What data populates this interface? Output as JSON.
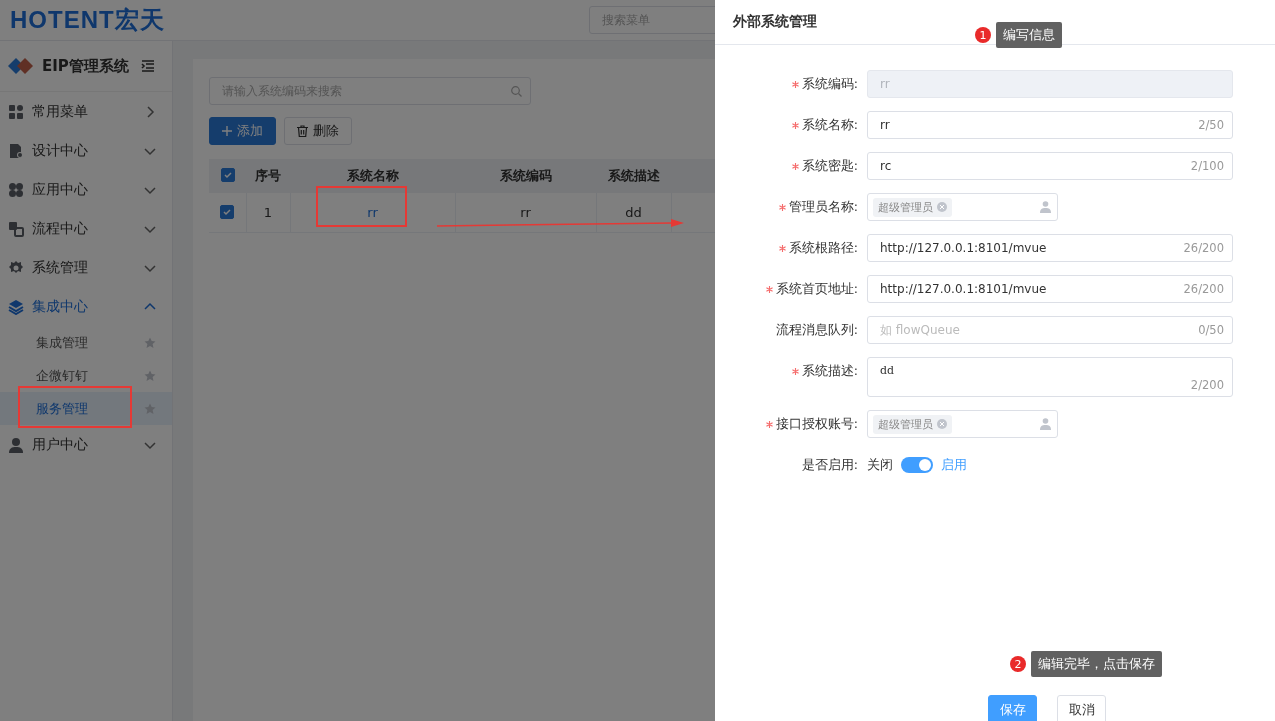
{
  "header": {
    "logo": "HOTENT宏天",
    "search_placeholder": "搜索菜单"
  },
  "sidebar": {
    "title": "EIP管理系统",
    "items": [
      {
        "label": "常用菜单",
        "kind": "flyout",
        "expanded": false,
        "selected": false
      },
      {
        "label": "设计中心",
        "kind": "group",
        "expanded": false,
        "selected": false
      },
      {
        "label": "应用中心",
        "kind": "group",
        "expanded": false,
        "selected": false
      },
      {
        "label": "流程中心",
        "kind": "group",
        "expanded": false,
        "selected": false
      },
      {
        "label": "系统管理",
        "kind": "group",
        "expanded": false,
        "selected": false
      },
      {
        "label": "集成中心",
        "kind": "group",
        "expanded": true,
        "selected": true,
        "children": [
          {
            "label": "集成管理",
            "selected": false
          },
          {
            "label": "企微钉钉",
            "selected": false
          },
          {
            "label": "服务管理",
            "selected": true
          }
        ]
      },
      {
        "label": "用户中心",
        "kind": "group",
        "expanded": false,
        "selected": false
      }
    ]
  },
  "toolbar": {
    "search_placeholder": "请输入系统编码来搜索",
    "buttons": [
      {
        "label": "添加",
        "kind": "primary"
      },
      {
        "label": "删除",
        "kind": "delete"
      }
    ]
  },
  "table": {
    "all_checked": true,
    "columns": [
      "序号",
      "系统名称",
      "系统编码",
      "系统描述"
    ],
    "rows": [
      {
        "checked": true,
        "cells": [
          "1",
          "rr",
          "rr",
          "dd"
        ]
      }
    ]
  },
  "drawer": {
    "title": "外部系统管理",
    "fields": [
      {
        "kind": "input",
        "label": "系统编码:",
        "required": true,
        "disabled": true,
        "value": "rr"
      },
      {
        "kind": "input",
        "label": "系统名称:",
        "required": true,
        "disabled": false,
        "value": "rr",
        "count": "2/50"
      },
      {
        "kind": "input",
        "label": "系统密匙:",
        "required": true,
        "disabled": false,
        "value": "rc",
        "count": "2/100"
      },
      {
        "kind": "tags",
        "label": "管理员名称:",
        "required": true,
        "tags": [
          "超级管理员"
        ]
      },
      {
        "kind": "input",
        "label": "系统根路径:",
        "required": true,
        "disabled": false,
        "value": "http://127.0.0.1:8101/mvue",
        "count": "26/200"
      },
      {
        "kind": "input",
        "label": "系统首页地址:",
        "required": true,
        "disabled": false,
        "value": "http://127.0.0.1:8101/mvue",
        "count": "26/200"
      },
      {
        "kind": "input",
        "label": "流程消息队列:",
        "required": false,
        "disabled": false,
        "placeholder": "如  flowQueue",
        "count": "0/50"
      },
      {
        "kind": "textarea",
        "label": "系统描述:",
        "required": true,
        "value": "dd",
        "count": "2/200"
      },
      {
        "kind": "tags",
        "label": "接口授权账号:",
        "required": true,
        "tags": [
          "超级管理员"
        ]
      },
      {
        "kind": "switch",
        "label": "是否启用:",
        "required": false,
        "on": true,
        "off_label": "关闭",
        "on_label": "启用"
      }
    ],
    "buttons": [
      {
        "label": "保存",
        "kind": "primary"
      },
      {
        "label": "取消",
        "kind": "default"
      }
    ]
  },
  "callouts": [
    {
      "number": "1",
      "text": "编写信息"
    },
    {
      "number": "2",
      "text": "编辑完毕，点击保存"
    }
  ]
}
